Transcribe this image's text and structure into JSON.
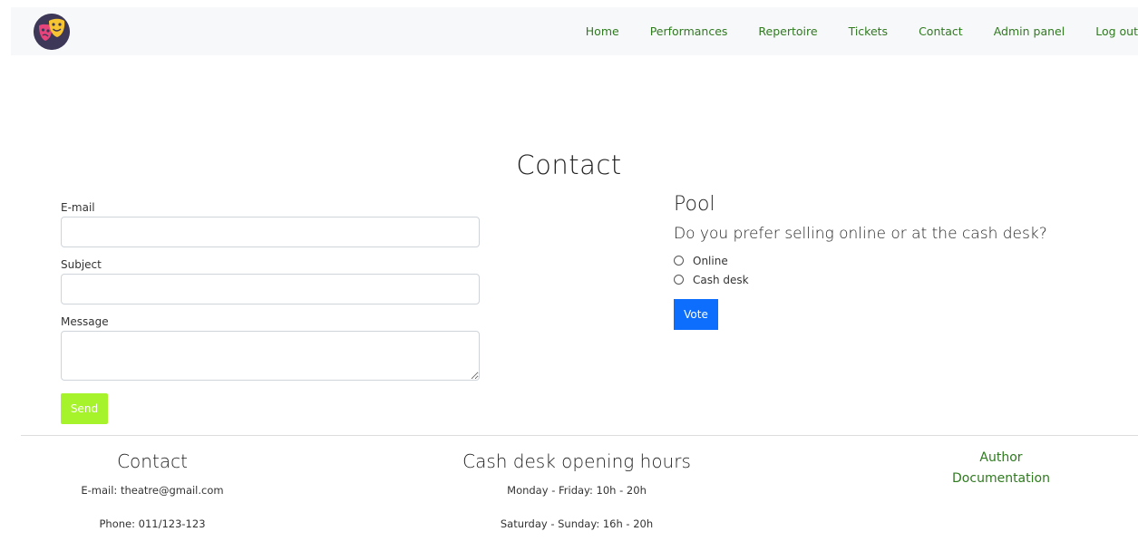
{
  "nav": {
    "logo": "theatre-masks-icon",
    "items": [
      {
        "label": "Home"
      },
      {
        "label": "Performances"
      },
      {
        "label": "Repertoire"
      },
      {
        "label": "Tickets"
      },
      {
        "label": "Contact"
      },
      {
        "label": "Admin panel"
      },
      {
        "label": "Log out"
      }
    ],
    "link_color": "#2f7a1f"
  },
  "page": {
    "title": "Contact"
  },
  "form": {
    "email_label": "E-mail",
    "email_value": "",
    "subject_label": "Subject",
    "subject_value": "",
    "message_label": "Message",
    "message_value": "",
    "send_label": "Send",
    "send_color": "#a6f22b"
  },
  "poll": {
    "title": "Pool",
    "question": "Do you prefer selling online or at the cash desk?",
    "options": [
      {
        "label": "Online",
        "checked": false
      },
      {
        "label": "Cash desk",
        "checked": false
      }
    ],
    "vote_label": "Vote",
    "vote_color": "#0d6efd"
  },
  "footer": {
    "contact": {
      "heading": "Contact",
      "email": "E-mail: theatre@gmail.com",
      "phone": "Phone: 011/123-123"
    },
    "hours": {
      "heading": "Cash desk opening hours",
      "weekdays": "Monday - Friday: 10h - 20h",
      "weekend": "Saturday - Sunday: 16h - 20h"
    },
    "links": [
      {
        "label": "Author"
      },
      {
        "label": "Documentation"
      }
    ]
  }
}
